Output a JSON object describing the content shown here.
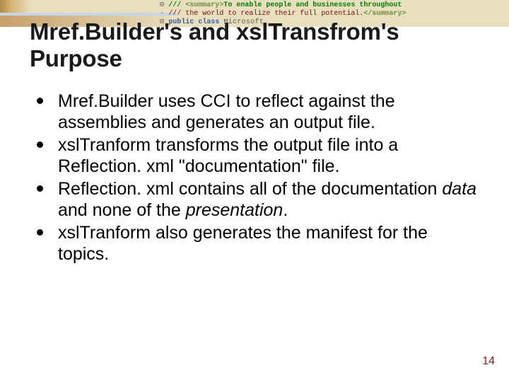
{
  "banner": {
    "code_lines": [
      {
        "prefix": "⊟",
        "prefix_color": "g-grey",
        "text1": "/// ",
        "color1": "g-green",
        "text2": "<summary>",
        "color2": "g-greentag",
        "text3": "To enable people and businesses throughout",
        "color3": "g-green"
      },
      {
        "prefix": "-",
        "prefix_color": "g-grey",
        "text1": "/// ",
        "color1": "g-maroon",
        "text2": "the world to realize their full potential.",
        "color2": "g-maroon",
        "text3": "</summary>",
        "color3": "g-greentag"
      },
      {
        "prefix": "⊟",
        "prefix_color": "g-grey",
        "text1": "public class ",
        "color1": "g-blue",
        "text2": "Microsoft",
        "color2": "g-grey",
        "text3": "",
        "color3": "g-grey"
      }
    ]
  },
  "title": "Mref.Builder's and xslTransfrom's Purpose",
  "bullets": [
    {
      "html": "Mref.Builder uses CCI to reflect against the assemblies and generates an output file."
    },
    {
      "html": "xslTranform transforms the output file into a Reflection. xml \"documentation\" file."
    },
    {
      "html": "Reflection. xml contains all of the documentation <em>data</em> and none of the <em>presentation</em>."
    },
    {
      "html": "xslTranform also generates the manifest for the topics."
    }
  ],
  "page_number": "14"
}
